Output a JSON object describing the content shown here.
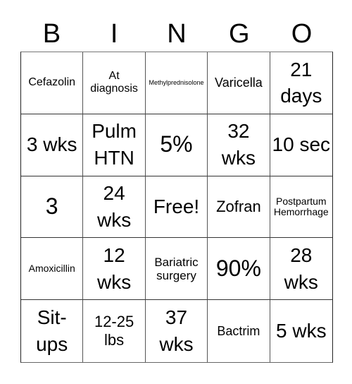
{
  "card": {
    "header": [
      "B",
      "I",
      "N",
      "G",
      "O"
    ],
    "rows": [
      [
        "Cefazolin",
        "At diagnosis",
        "Methylprednisolone",
        "Varicella",
        "21 days"
      ],
      [
        "3 wks",
        "Pulm HTN",
        "5%",
        "32 wks",
        "10 sec"
      ],
      [
        "3",
        "24 wks",
        "Free!",
        "Zofran",
        "Postpartum Hemorrhage"
      ],
      [
        "Amoxicillin",
        "12 wks",
        "Bariatric surgery",
        "90%",
        "28 wks"
      ],
      [
        "Sit-ups",
        "12-25 lbs",
        "37 wks",
        "Bactrim",
        "5 wks"
      ]
    ],
    "free_space": "Free!"
  }
}
